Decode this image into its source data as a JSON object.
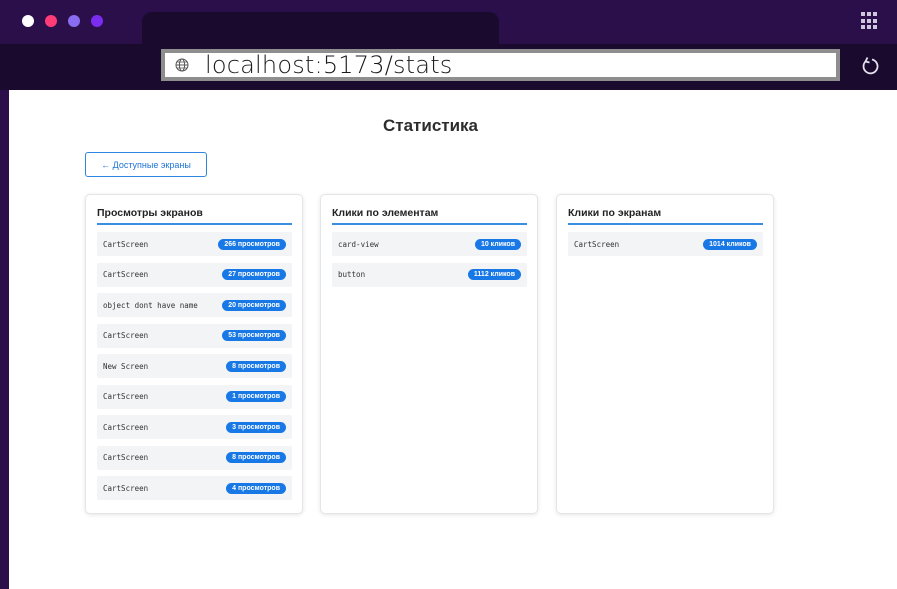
{
  "browser": {
    "traffic_colors": [
      "#ffffff",
      "#ff3b78",
      "#8a6cf0",
      "#7a2cf0"
    ],
    "url": "localhost:5173/stats"
  },
  "page": {
    "title": "Статистика",
    "back_label": "← Доступные экраны"
  },
  "cards": [
    {
      "title": "Просмотры экранов",
      "rows": [
        {
          "label": "CartScreen",
          "badge": "266 просмотров"
        },
        {
          "label": "CartScreen",
          "badge": "27 просмотров"
        },
        {
          "label": "object dont have name",
          "badge": "20 просмотров"
        },
        {
          "label": "CartScreen",
          "badge": "53 просмотров"
        },
        {
          "label": "New Screen",
          "badge": "8 просмотров"
        },
        {
          "label": "CartScreen",
          "badge": "1 просмотров"
        },
        {
          "label": "CartScreen",
          "badge": "3 просмотров"
        },
        {
          "label": "CartScreen",
          "badge": "8 просмотров"
        },
        {
          "label": "CartScreen",
          "badge": "4 просмотров"
        }
      ]
    },
    {
      "title": "Клики по элементам",
      "rows": [
        {
          "label": "card-view",
          "badge": "10 кликов"
        },
        {
          "label": "button",
          "badge": "1112 кликов"
        }
      ]
    },
    {
      "title": "Клики по экранам",
      "rows": [
        {
          "label": "CartScreen",
          "badge": "1014 кликов"
        }
      ]
    }
  ]
}
